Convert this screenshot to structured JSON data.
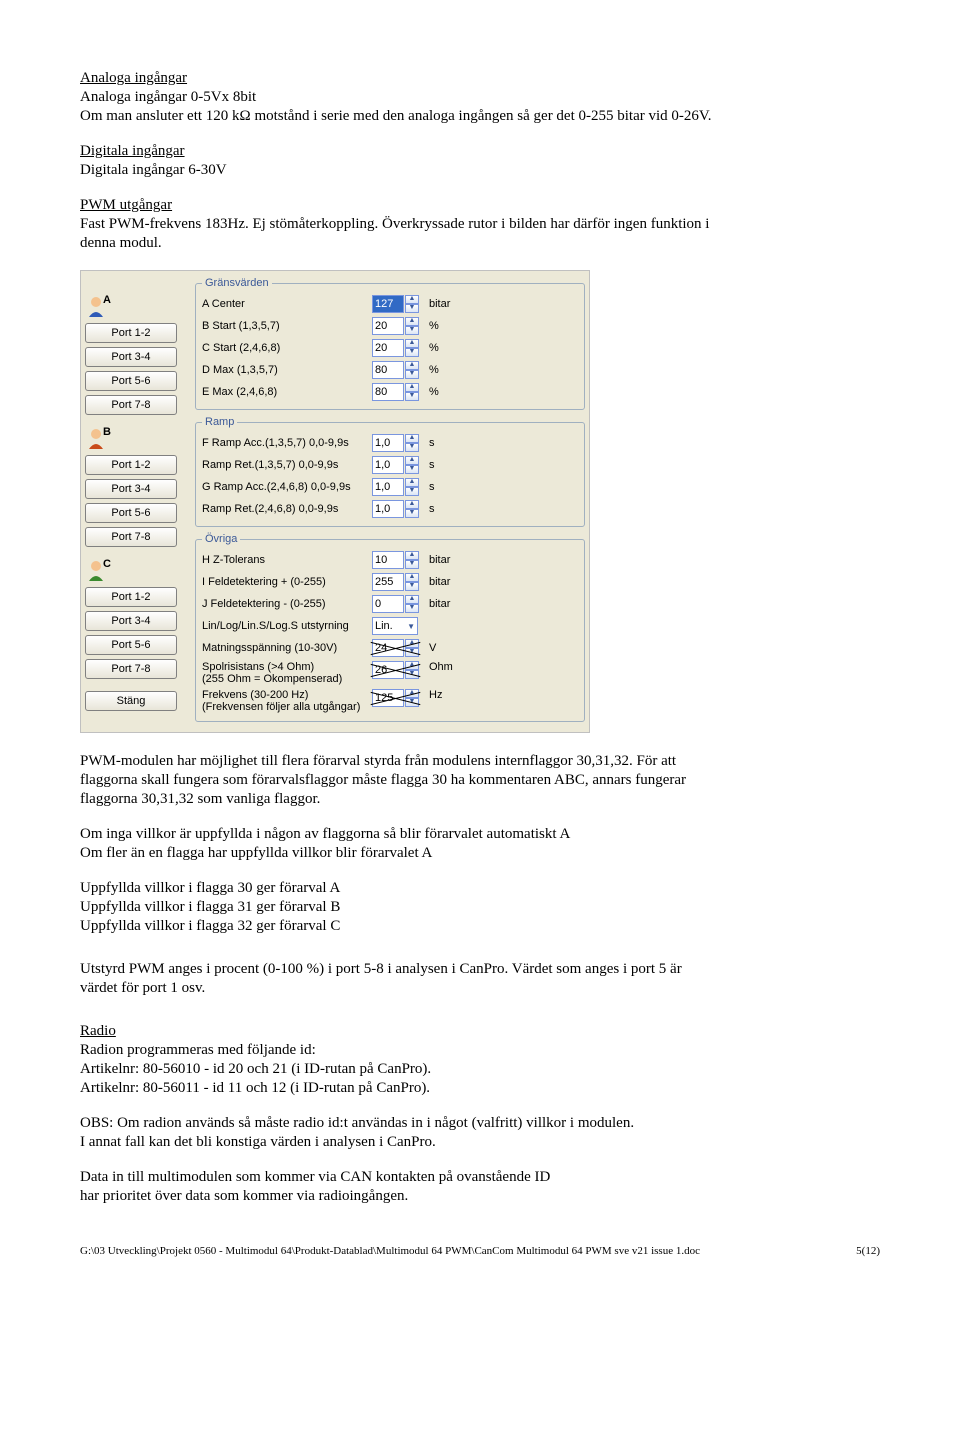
{
  "text": {
    "h_analog": "Analoga ingångar",
    "analog_line": "Analoga ingångar 0-5Vx 8bit",
    "analog_desc": "Om man ansluter ett 120 kΩ motstånd i serie med den analoga ingången så ger det 0-255 bitar vid 0-26V.",
    "h_digital": "Digitala ingångar",
    "digital_line": "Digitala ingångar 6-30V",
    "h_pwm": "PWM utgångar",
    "pwm_line1": "Fast PWM-frekvens 183Hz. Ej stömåterkoppling. Överkryssade rutor i bilden har därför ingen funktion i",
    "pwm_line2": "denna modul.",
    "p_pwm_mod1": "PWM-modulen har möjlighet till flera förarval styrda från modulens internflaggor 30,31,32. För att",
    "p_pwm_mod2": "flaggorna skall fungera som förarvalsflaggor måste flagga 30 ha kommentaren ABC, annars fungerar",
    "p_pwm_mod3": "flaggorna 30,31,32 som vanliga flaggor.",
    "p_cond1": "Om inga villkor är uppfyllda i någon av flaggorna så blir förarvalet automatiskt A",
    "p_cond2": "Om fler än en flagga har uppfyllda villkor blir förarvalet A",
    "p_vA": "Uppfyllda villkor i flagga 30 ger förarval  A",
    "p_vB": "Uppfyllda villkor i flagga 31 ger förarval  B",
    "p_vC": "Uppfyllda villkor i flagga 32 ger förarval  C",
    "p_ut1": "Utstyrd PWM anges i procent (0-100 %) i port 5-8 i analysen i CanPro. Värdet som anges i port 5 är",
    "p_ut2": "värdet för port 1 osv.",
    "h_radio": "Radio",
    "radio1": "Radion programmeras med följande id:",
    "radio2": "Artikelnr: 80-56010 - id 20 och 21 (i ID-rutan på CanPro).",
    "radio3": "Artikelnr: 80-56011 - id 11 och 12 (i ID-rutan på CanPro).",
    "obs1": "OBS: Om radion används så måste radio id:t användas in  i något (valfritt) villkor i modulen.",
    "obs2": "I annat fall kan det bli konstiga värden i analysen i CanPro.",
    "data1": "Data in till multimodulen som kommer via CAN kontakten på ovanstående ID",
    "data2": "har prioritet över data som kommer via radioingången.",
    "footer_path": "G:\\03 Utveckling\\Projekt 0560 - Multimodul 64\\Produkt-Datablad\\Multimodul 64 PWM\\CanCom Multimodul 64 PWM sve v21 issue 1.doc",
    "footer_page": "5(12)"
  },
  "panel": {
    "ports": [
      "Port 1-2",
      "Port 3-4",
      "Port 5-6",
      "Port 7-8"
    ],
    "close": "Stäng",
    "groups": {
      "grans": {
        "legend": "Gränsvärden",
        "rows": [
          {
            "l": "A   Center",
            "v": "127",
            "u": "bitar",
            "hi": true
          },
          {
            "l": "B   Start (1,3,5,7)",
            "v": "20",
            "u": "%"
          },
          {
            "l": "C   Start (2,4,6,8)",
            "v": "20",
            "u": "%"
          },
          {
            "l": "D   Max (1,3,5,7)",
            "v": "80",
            "u": "%"
          },
          {
            "l": "E   Max (2,4,6,8)",
            "v": "80",
            "u": "%"
          }
        ]
      },
      "ramp": {
        "legend": "Ramp",
        "rows": [
          {
            "l": "F   Ramp Acc.(1,3,5,7) 0,0-9,9s",
            "v": "1,0",
            "u": "s"
          },
          {
            "l": "     Ramp Ret.(1,3,5,7) 0,0-9,9s",
            "v": "1,0",
            "u": "s"
          },
          {
            "l": "G   Ramp Acc.(2,4,6,8) 0,0-9,9s",
            "v": "1,0",
            "u": "s"
          },
          {
            "l": "     Ramp Ret.(2,4,6,8) 0,0-9,9s",
            "v": "1,0",
            "u": "s"
          }
        ]
      },
      "ovriga": {
        "legend": "Övriga",
        "rows": [
          {
            "l": "H   Z-Tolerans",
            "v": "10",
            "u": "bitar"
          },
          {
            "l": "I    Feldetektering + (0-255)",
            "v": "255",
            "u": "bitar"
          },
          {
            "l": "J   Feldetektering - (0-255)",
            "v": "0",
            "u": "bitar"
          }
        ],
        "lin_label": "Lin/Log/Lin.S/Log.S utstyrning",
        "lin_value": "Lin.",
        "mat_l1": "Matningsspänning (10-30V)",
        "mat_v": "24",
        "mat_u": "V",
        "spol_l1": "Spolrisistans (>4 Ohm)",
        "spol_l2": "(255 Ohm = Okompenserad)",
        "spol_v": "26",
        "spol_u": "Ohm",
        "frek_l1": "Frekvens (30-200 Hz)",
        "frek_l2": "(Frekvensen följer alla utgångar)",
        "frek_v": "125",
        "frek_u": "Hz"
      }
    }
  }
}
